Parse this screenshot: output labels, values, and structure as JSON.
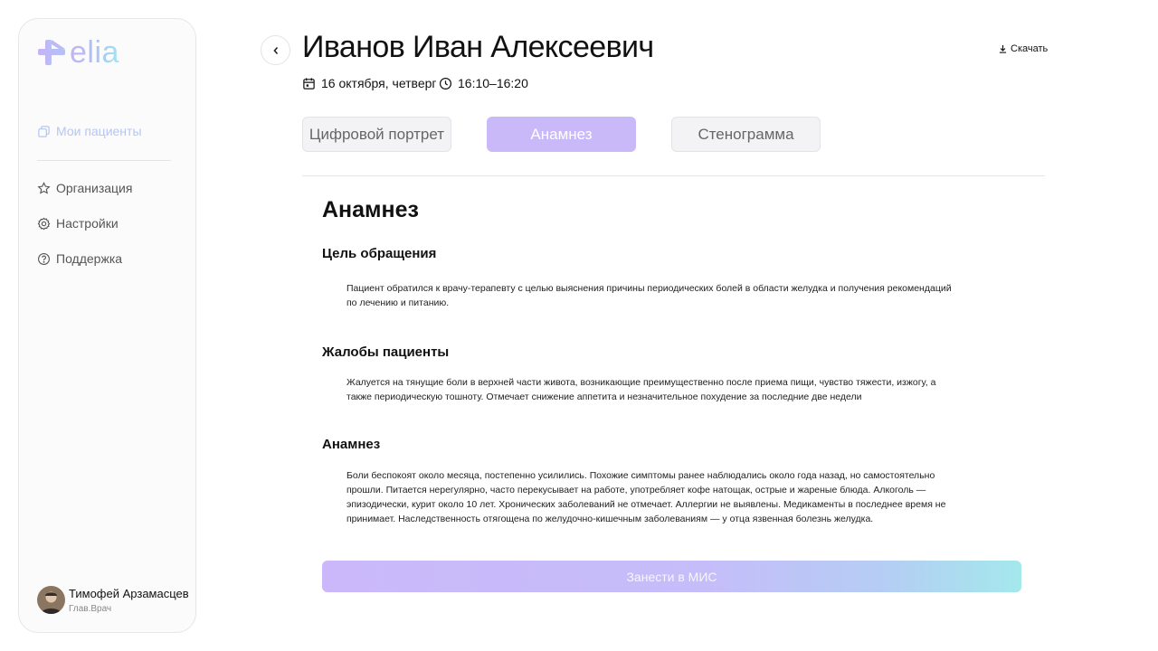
{
  "app": {
    "logo_text": "elia"
  },
  "sidebar": {
    "items": [
      {
        "label": "Мои пациенты",
        "icon": "patients-icon",
        "active": true
      },
      {
        "label": "Организация",
        "icon": "star-icon",
        "active": false
      },
      {
        "label": "Настройки",
        "icon": "gear-icon",
        "active": false
      },
      {
        "label": "Поддержка",
        "icon": "help-circle-icon",
        "active": false
      }
    ],
    "user": {
      "name": "Тимофей Арзамасцев",
      "role": "Глав.Врач"
    }
  },
  "header": {
    "patient_name": "Иванов Иван Алексеевич",
    "date": "16 октября, четверг",
    "time": "16:10–16:20",
    "download_label": "Скачать"
  },
  "tabs": [
    {
      "label": "Цифровой портрет",
      "active": false
    },
    {
      "label": "Анамнез",
      "active": true
    },
    {
      "label": "Стенограмма",
      "active": false
    }
  ],
  "content": {
    "title": "Анамнез",
    "sections": [
      {
        "heading": "Цель обращения",
        "text": "Пациент обратился к врачу-терапевту с целью выяснения причины периодических болей в области желудка и получения рекомендаций по лечению и питанию."
      },
      {
        "heading": "Жалобы пациенты",
        "text": "Жалуется на тянущие боли в верхней части живота, возникающие преимущественно после приема пищи, чувство тяжести, изжогу, а также периодическую тошноту. Отмечает снижение аппетита и незначительное похудение за последние две недели"
      },
      {
        "heading": "Анамнез",
        "text": "Боли беспокоят около месяца, постепенно усилились. Похожие симптомы ранее наблюдались около года назад, но самостоятельно прошли. Питается нерегулярно, часто перекусывает на работе, употребляет кофе натощак, острые и жареные блюда. Алкоголь — эпизодически, курит около 10 лет. Хронических заболеваний не отмечает. Аллергии не выявлены. Медикаменты в последнее время не принимает. Наследственность отягощена по желудочно-кишечным заболеваниям — у отца язвенная болезнь желудка."
      }
    ],
    "submit_label": "Занести в  МИС"
  },
  "colors": {
    "accent": "#c9b9f8",
    "gradient_end": "#a4e8ec"
  }
}
